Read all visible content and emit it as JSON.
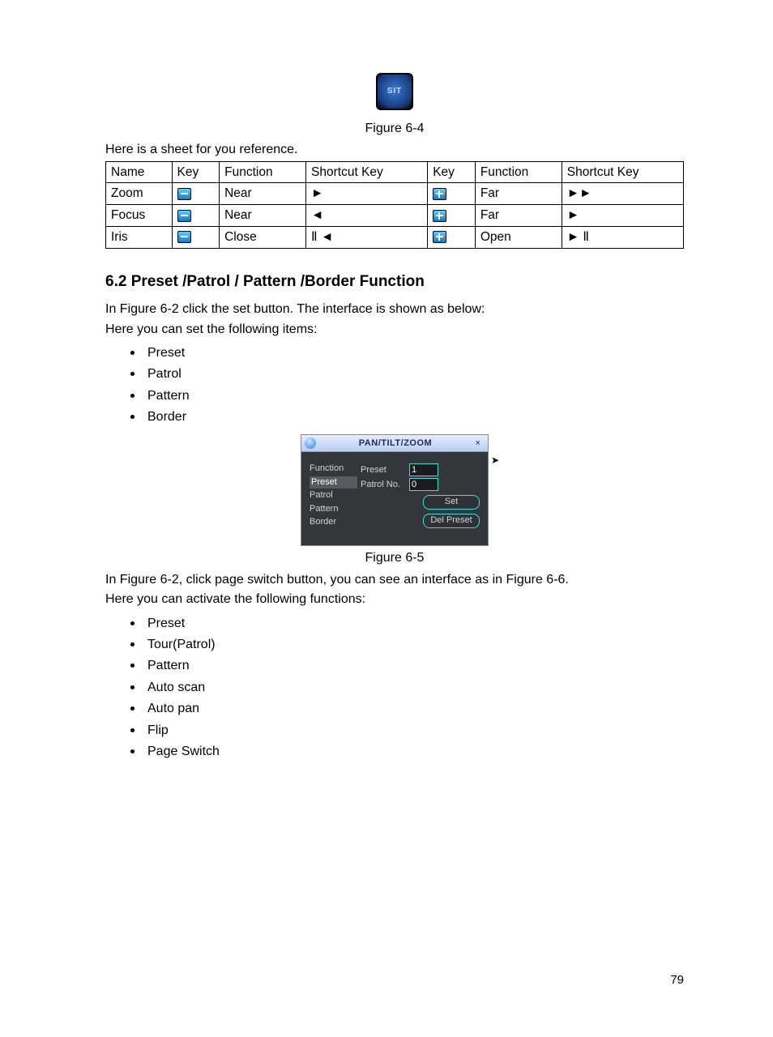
{
  "sit_label": "SIT",
  "figure64_caption": "Figure 6-4",
  "intro_sheet": "Here is a sheet for you reference.",
  "table": {
    "headers": [
      "Name",
      "Key",
      "Function",
      "Shortcut Key",
      "Key",
      "Function",
      "Shortcut Key"
    ],
    "rows": [
      {
        "name": "Zoom",
        "key1": "minus",
        "fn1": "Near",
        "sk1": "►",
        "key2": "plus",
        "fn2": "Far",
        "sk2": "►►"
      },
      {
        "name": "Focus",
        "key1": "minus",
        "fn1": "Near",
        "sk1": "◄",
        "key2": "plus",
        "fn2": "Far",
        "sk2": "►"
      },
      {
        "name": "Iris",
        "key1": "minus",
        "fn1": "Close",
        "sk1": "Ⅱ ◄",
        "key2": "plus",
        "fn2": "Open",
        "sk2": "► Ⅱ"
      }
    ]
  },
  "section_heading": "6.2  Preset  /Patrol / Pattern /Border  Function",
  "para_set1": "In Figure 6-2 click the set button. The interface is shown as below:",
  "para_set2": "Here you can set the following items:",
  "list_set": [
    "Preset",
    "Patrol",
    "Pattern",
    "Border"
  ],
  "ptz": {
    "title": "PAN/TILT/ZOOM",
    "close": "×",
    "function_label": "Function",
    "items": [
      "Preset",
      "Patrol",
      "Pattern",
      "Border"
    ],
    "selected": "Preset",
    "preset_label": "Preset",
    "preset_value": "1",
    "patrolno_label": "Patrol No.",
    "patrolno_value": "0",
    "set_btn": "Set",
    "del_btn": "Del Preset"
  },
  "figure65_caption": "Figure 6-5",
  "para_act1": "In Figure 6-2, click page switch button, you can see an interface as in Figure 6-6.",
  "para_act2": "Here you can activate the following functions:",
  "list_act": [
    "Preset",
    "Tour(Patrol)",
    "Pattern",
    "Auto scan",
    "Auto pan",
    "Flip",
    "Page Switch"
  ],
  "page_number": "79"
}
